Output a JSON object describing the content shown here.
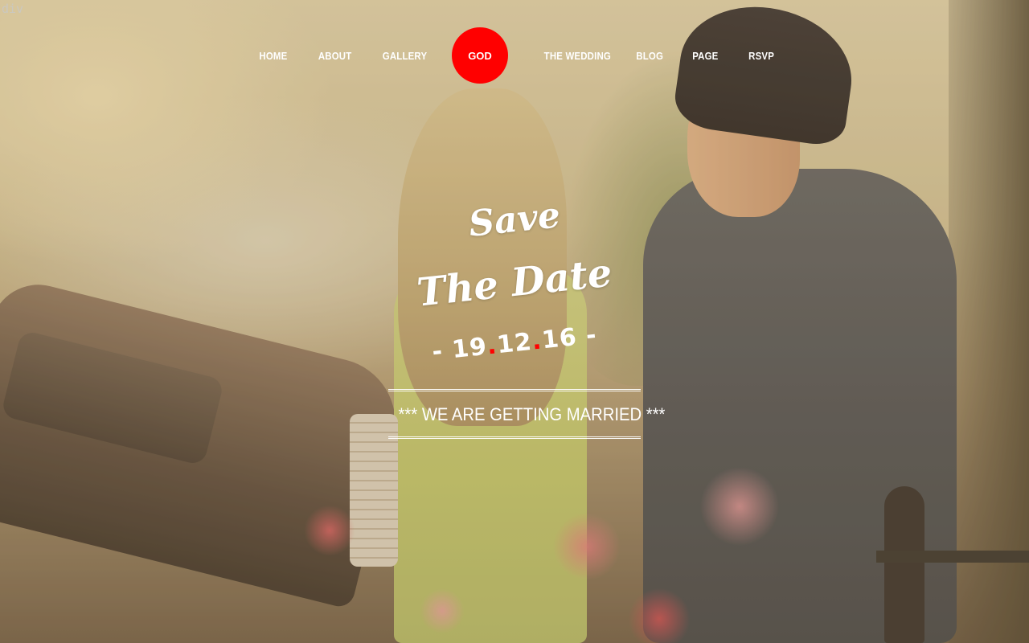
{
  "debug": {
    "element_tag": "div"
  },
  "nav": {
    "items": [
      {
        "label": "HOME"
      },
      {
        "label": "ABOUT"
      },
      {
        "label": "GALLERY"
      },
      {
        "label": "THE WEDDING"
      },
      {
        "label": "BLOG"
      },
      {
        "label": "PAGE"
      },
      {
        "label": "RSVP"
      }
    ],
    "logo": {
      "label": "GOD",
      "color": "#ff0000"
    }
  },
  "hero": {
    "headline_line1": "Save",
    "headline_line2": "The Date",
    "date": {
      "prefix": "- ",
      "day": "19",
      "month": "12",
      "year": "16",
      "suffix": " -",
      "separator_color": "#ff0000"
    },
    "tagline": "*** WE ARE GETTING MARRIED ***"
  },
  "colors": {
    "accent": "#ff0000",
    "text": "#ffffff"
  }
}
